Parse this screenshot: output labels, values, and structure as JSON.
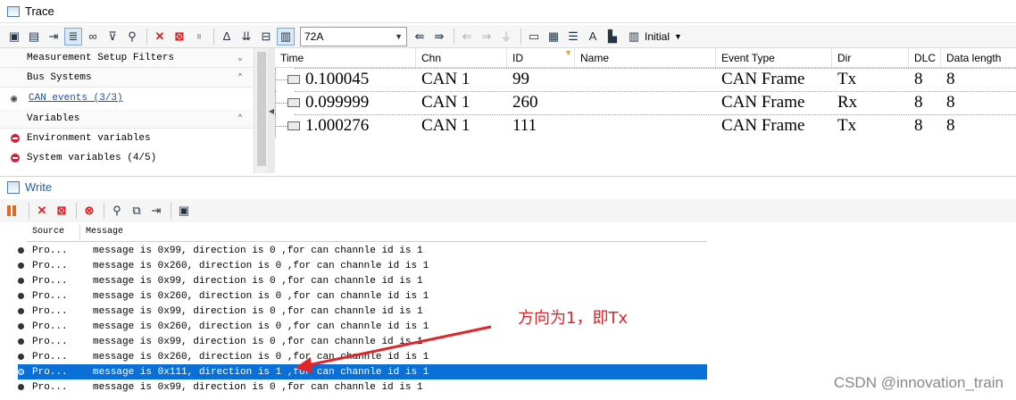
{
  "trace": {
    "title": "Trace",
    "toolbar": {
      "filter_value": "72A",
      "initial_label": "Initial"
    }
  },
  "filters": {
    "measurement_setup": "Measurement Setup Filters",
    "bus_systems": "Bus Systems",
    "can_events": "CAN events (3/3)",
    "variables": "Variables",
    "environment_variables": "Environment variables",
    "system_variables": "System variables (4/5)"
  },
  "trace_columns": [
    "Time",
    "Chn",
    "ID",
    "Name",
    "Event Type",
    "Dir",
    "DLC",
    "Data length"
  ],
  "trace_rows": [
    {
      "time": "0.100045",
      "chn": "CAN 1",
      "id": "99",
      "name": "",
      "event": "CAN Frame",
      "dir": "Tx",
      "dlc": "8",
      "len": "8"
    },
    {
      "time": "0.099999",
      "chn": "CAN 1",
      "id": "260",
      "name": "",
      "event": "CAN Frame",
      "dir": "Rx",
      "dlc": "8",
      "len": "8"
    },
    {
      "time": "1.000276",
      "chn": "CAN 1",
      "id": "111",
      "name": "",
      "event": "CAN Frame",
      "dir": "Tx",
      "dlc": "8",
      "len": "8"
    }
  ],
  "write": {
    "title": "Write",
    "columns": [
      "Source",
      "Message"
    ],
    "rows": [
      {
        "src": "Pro...",
        "msg": "message is 0x99, direction is 0 ,for can channle id is 1"
      },
      {
        "src": "Pro...",
        "msg": "message is 0x260, direction is 0 ,for can channle id is 1"
      },
      {
        "src": "Pro...",
        "msg": "message is 0x99, direction is 0 ,for can channle id is 1"
      },
      {
        "src": "Pro...",
        "msg": "message is 0x260, direction is 0 ,for can channle id is 1"
      },
      {
        "src": "Pro...",
        "msg": "message is 0x99, direction is 0 ,for can channle id is 1"
      },
      {
        "src": "Pro...",
        "msg": "message is 0x260, direction is 0 ,for can channle id is 1"
      },
      {
        "src": "Pro...",
        "msg": "message is 0x99, direction is 0 ,for can channle id is 1"
      },
      {
        "src": "Pro...",
        "msg": "message is 0x260, direction is 0 ,for can channle id is 1"
      },
      {
        "src": "Pro...",
        "msg": "message is 0x111, direction is 1 ,for can channle id is 1"
      },
      {
        "src": "Pro...",
        "msg": "message is 0x99, direction is 0 ,for can channle id is 1"
      }
    ],
    "selected_index": 8
  },
  "annotation": "方向为1，即Tx",
  "watermark": "CSDN @innovation_train",
  "colors": {
    "selection": "#0a6fd6",
    "annotation": "#e0262a",
    "accent": "#1f63b0"
  }
}
